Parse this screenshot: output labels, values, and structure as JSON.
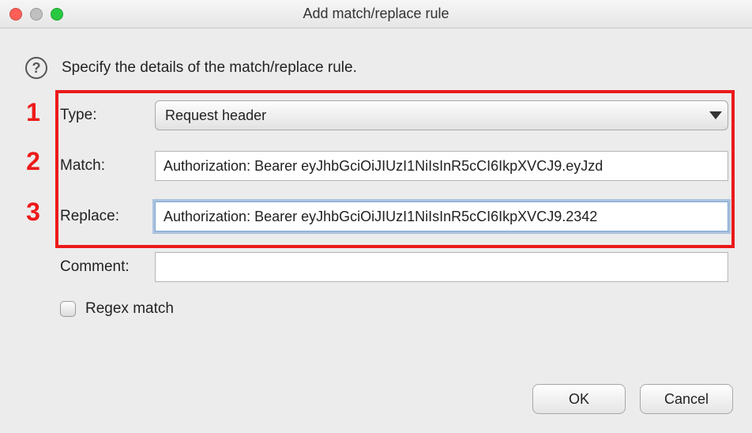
{
  "window": {
    "title": "Add match/replace rule"
  },
  "instruction": "Specify the details of the match/replace rule.",
  "labels": {
    "type": "Type:",
    "match": "Match:",
    "replace": "Replace:",
    "comment": "Comment:",
    "regex": "Regex match"
  },
  "fields": {
    "type_value": "Request header",
    "match_value": "Authorization: Bearer eyJhbGciOiJIUzI1NiIsInR5cCI6IkpXVCJ9.eyJzd",
    "replace_value": "Authorization: Bearer eyJhbGciOiJIUzI1NiIsInR5cCI6IkpXVCJ9.2342",
    "comment_value": ""
  },
  "buttons": {
    "ok": "OK",
    "cancel": "Cancel"
  },
  "annotations": {
    "n1": "1",
    "n2": "2",
    "n3": "3"
  },
  "icons": {
    "help": "?"
  }
}
